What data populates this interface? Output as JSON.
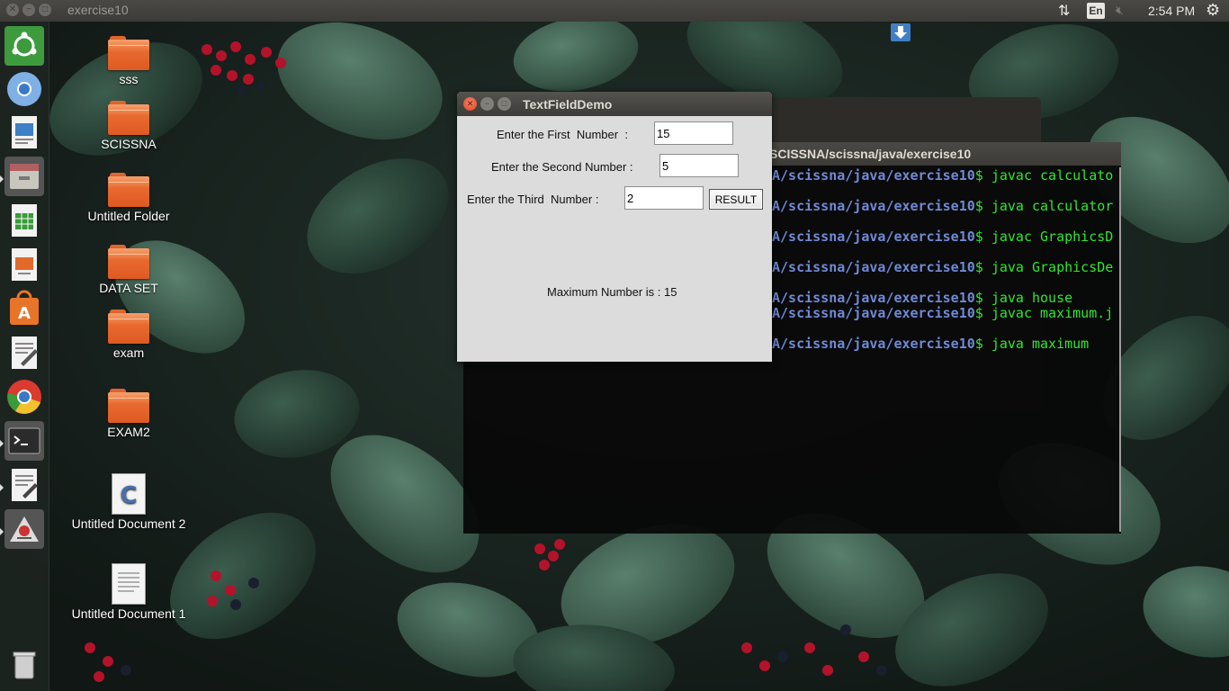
{
  "top_panel": {
    "window_title": "exercise10",
    "language": "En",
    "clock": "2:54 PM"
  },
  "launcher": {
    "items": [
      "ubuntu-dash",
      "chromium-browser",
      "libreoffice-writer",
      "file-manager",
      "libreoffice-calc",
      "libreoffice-impress",
      "ubuntu-software",
      "text-editor",
      "google-chrome",
      "terminal",
      "gedit",
      "java-app",
      "trash"
    ]
  },
  "desktop_icons": [
    {
      "label": "sss",
      "type": "folder"
    },
    {
      "label": "SCISSNA",
      "type": "folder"
    },
    {
      "label": "Untitled Folder",
      "type": "folder"
    },
    {
      "label": "DATA SET",
      "type": "folder"
    },
    {
      "label": "exam",
      "type": "folder"
    },
    {
      "label": "EXAM2",
      "type": "folder"
    },
    {
      "label": "Untitled Document 2",
      "type": "c-source"
    },
    {
      "label": "Untitled Document 1",
      "type": "text-document"
    }
  ],
  "terminal": {
    "title": "SCISSNA/scissna/java/exercise10",
    "lines": [
      {
        "path": "A/scissna/java/exercise10",
        "cmd": "$ javac calculato"
      },
      {
        "path": "A/scissna/java/exercise10",
        "cmd": "$ java calculator"
      },
      {
        "path": "A/scissna/java/exercise10",
        "cmd": "$ javac GraphicsD"
      },
      {
        "path": "A/scissna/java/exercise10",
        "cmd": "$ java GraphicsDe"
      },
      {
        "path": "A/scissna/java/exercise10",
        "cmd": "$ java house"
      },
      {
        "path": "A/scissna/java/exercise10",
        "cmd": "$ javac maximum.j"
      },
      {
        "path": "A/scissna/java/exercise10",
        "cmd": "$ java maximum"
      }
    ]
  },
  "textfield_demo": {
    "title": "TextFieldDemo",
    "first_label": "Enter the First  Number  :",
    "first_value": "15",
    "second_label": "Enter the Second Number :",
    "second_value": "5",
    "third_label": "Enter the Third  Number :",
    "third_value": "2",
    "result_button": "RESULT",
    "max_text": "Maximum Number is : 15"
  }
}
